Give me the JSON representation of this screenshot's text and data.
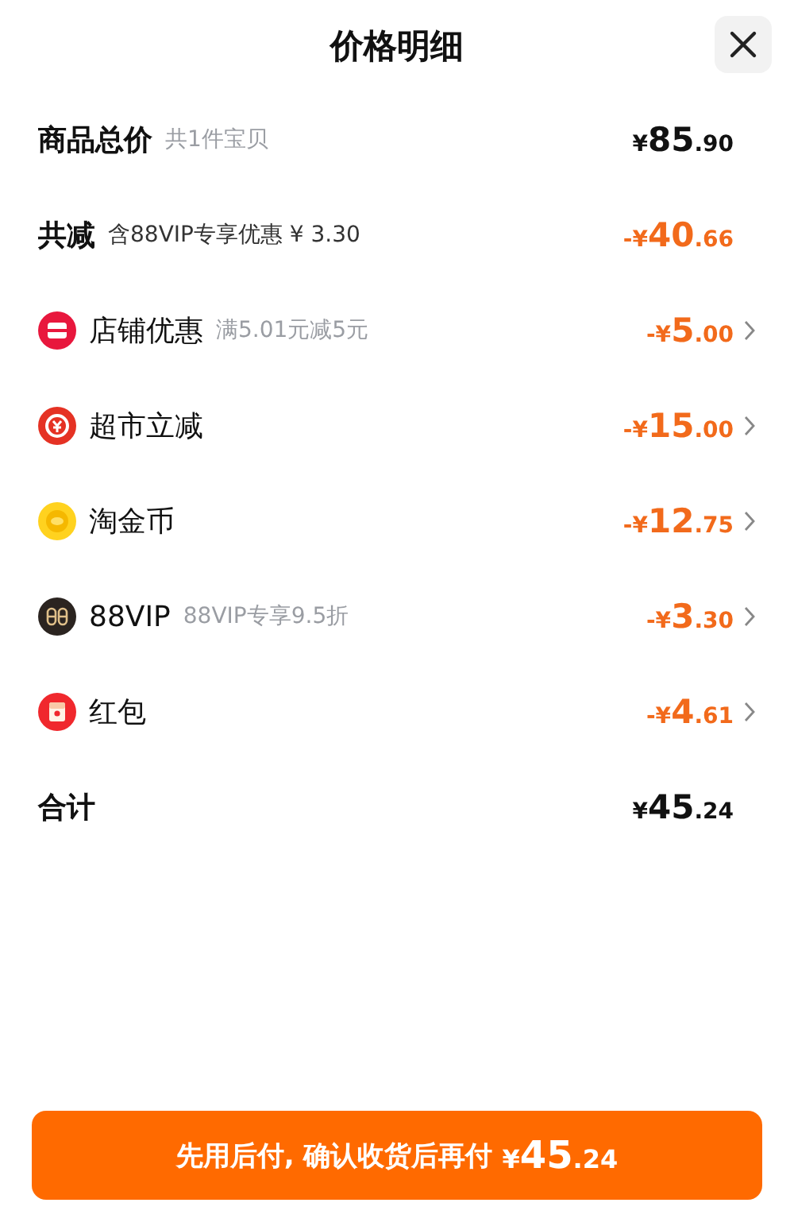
{
  "title": "价格明细",
  "rows": [
    {
      "kind": "summary",
      "label": "商品总价",
      "note": "共1件宝贝",
      "amount": "¥85.90"
    },
    {
      "kind": "reduction",
      "label": "共减",
      "note": "含88VIP专享优惠 ¥ 3.30",
      "amount": "-¥40.66"
    },
    {
      "kind": "store",
      "label": "店铺优惠",
      "note": "满5.01元减5元",
      "amount": "-¥5.00"
    },
    {
      "kind": "market",
      "label": "超市立减",
      "amount": "-¥15.00"
    },
    {
      "kind": "coin",
      "label": "淘金币",
      "amount": "-¥12.75"
    },
    {
      "kind": "vip",
      "label": "88VIP",
      "note": "88VIP专享9.5折",
      "amount": "-¥3.30"
    },
    {
      "kind": "packet",
      "label": "红包",
      "amount": "-¥4.61"
    },
    {
      "kind": "summary",
      "label": "合计",
      "amount": "¥45.24"
    }
  ],
  "button": {
    "label": "先用后付, 确认收货后再付",
    "amount": "¥45.24"
  }
}
